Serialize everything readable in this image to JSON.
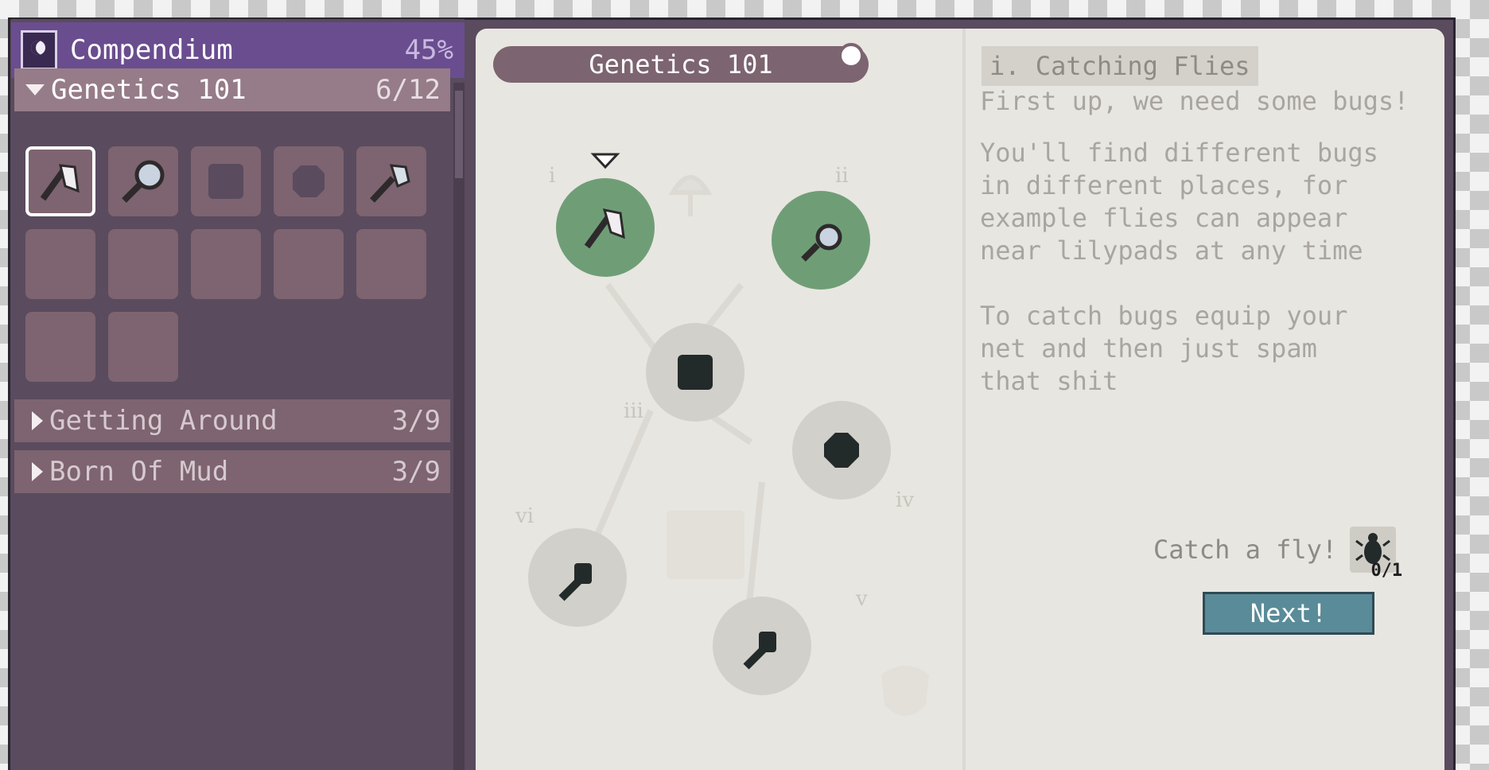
{
  "sidebar": {
    "title": "Compendium",
    "progress_percent": "45%",
    "sections": [
      {
        "title": "Genetics 101",
        "count": "6/12",
        "expanded": true
      },
      {
        "title": "Getting Around",
        "count": "3/9",
        "expanded": false
      },
      {
        "title": "Born Of Mud",
        "count": "3/9",
        "expanded": false
      }
    ],
    "slots": [
      {
        "icon": "net-icon",
        "state": "selected"
      },
      {
        "icon": "magnifier-icon",
        "state": "unlocked"
      },
      {
        "icon": "block-icon",
        "state": "locked"
      },
      {
        "icon": "blob-icon",
        "state": "locked"
      },
      {
        "icon": "axe-icon",
        "state": "unlocked"
      },
      {
        "icon": "",
        "state": "empty"
      },
      {
        "icon": "",
        "state": "empty"
      },
      {
        "icon": "",
        "state": "empty"
      },
      {
        "icon": "",
        "state": "empty"
      },
      {
        "icon": "",
        "state": "empty"
      },
      {
        "icon": "",
        "state": "empty"
      },
      {
        "icon": "",
        "state": "empty"
      }
    ]
  },
  "tree": {
    "title": "Genetics 101",
    "nodes": [
      {
        "label": "i",
        "icon": "net-icon",
        "state": "complete"
      },
      {
        "label": "ii",
        "icon": "magnifier-icon",
        "state": "complete"
      },
      {
        "label": "iii",
        "icon": "block-icon",
        "state": "locked"
      },
      {
        "label": "iv",
        "icon": "blob-icon",
        "state": "locked"
      },
      {
        "label": "v",
        "icon": "axe-icon",
        "state": "locked"
      },
      {
        "label": "vi",
        "icon": "axe-icon",
        "state": "locked"
      }
    ]
  },
  "lesson": {
    "title": "i. Catching Flies",
    "subtitle": "First up, we need some bugs!",
    "body": "You'll find different bugs\nin different places, for\nexample flies can appear\nnear lilypads at any time\n\nTo catch bugs equip your\nnet and then just spam\nthat shit",
    "task_label": "Catch a fly!",
    "task_icon": "fly-icon",
    "task_progress": "0/1",
    "next_label": "Next!"
  },
  "colors": {
    "header": "#6a4d8f",
    "sidebar": "#5a4b5e",
    "panel": "#e8e6e1",
    "node_complete": "#6f9e76",
    "node_locked": "#d2d0cb",
    "next_button": "#5a8b98"
  }
}
